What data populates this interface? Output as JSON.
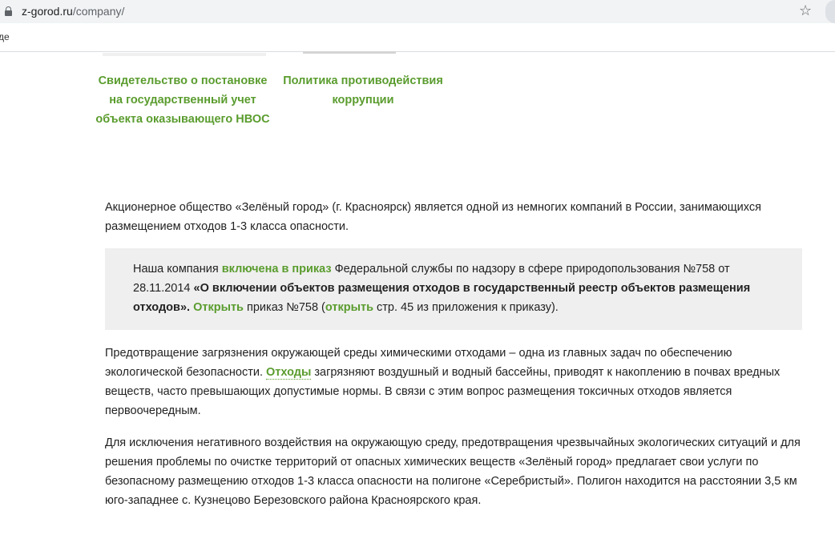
{
  "browser": {
    "url_domain": "z-gorod.ru",
    "url_path": "/company/",
    "bookmark_fragment": "де"
  },
  "documents": [
    {
      "label": "Свидетельство о постановке на государственный учет объекта оказывающего НВОС"
    },
    {
      "label": "Политика противодействия коррупции"
    }
  ],
  "intro": "Акционерное общество «Зелёный город» (г. Красноярск) является одной из немногих компаний в России, занимающихся размещением отходов 1-3 класса опасности.",
  "quote": {
    "text_1": "Наша компания ",
    "link_1": "включена в приказ",
    "text_2": " Федеральной службы по надзору в сфере природопользования №758 от 28.11.2014 ",
    "bold": "«О включении объектов размещения отходов в государственный реестр объектов размещения отходов».",
    "text_3": " ",
    "link_2": "Открыть",
    "text_4": " приказ №758 (",
    "link_3": "открыть",
    "text_5": " стр. 45 из приложения к приказу)."
  },
  "para2": {
    "text_1": "Предотвращение загрязнения окружающей среды химическими отходами – одна из главных задач по обеспечению экологической безопасности. ",
    "link": "Отходы",
    "text_2": " загрязняют воздушный и водный бассейны, приводят к накоплению в почвах вредных веществ, часто превышающих допустимые нормы. В связи с этим вопрос размещения токсичных отходов является первоочередным."
  },
  "para3": "Для исключения негативного воздействия на окружающую среду, предотвращения чрезвычайных экологических ситуаций и для решения проблемы по очистке территорий от опасных химических веществ «Зелёный город» предлагает свои услуги по безопасному размещению отходов 1-3 класса опасности на полигоне «Серебристый». Полигон находится на расстоянии 3,5 км юго-западнее с. Кузнецово Березовского района Красноярского края.",
  "colors": {
    "accent_green": "#5a9c2e",
    "quote_background": "#efefef"
  }
}
